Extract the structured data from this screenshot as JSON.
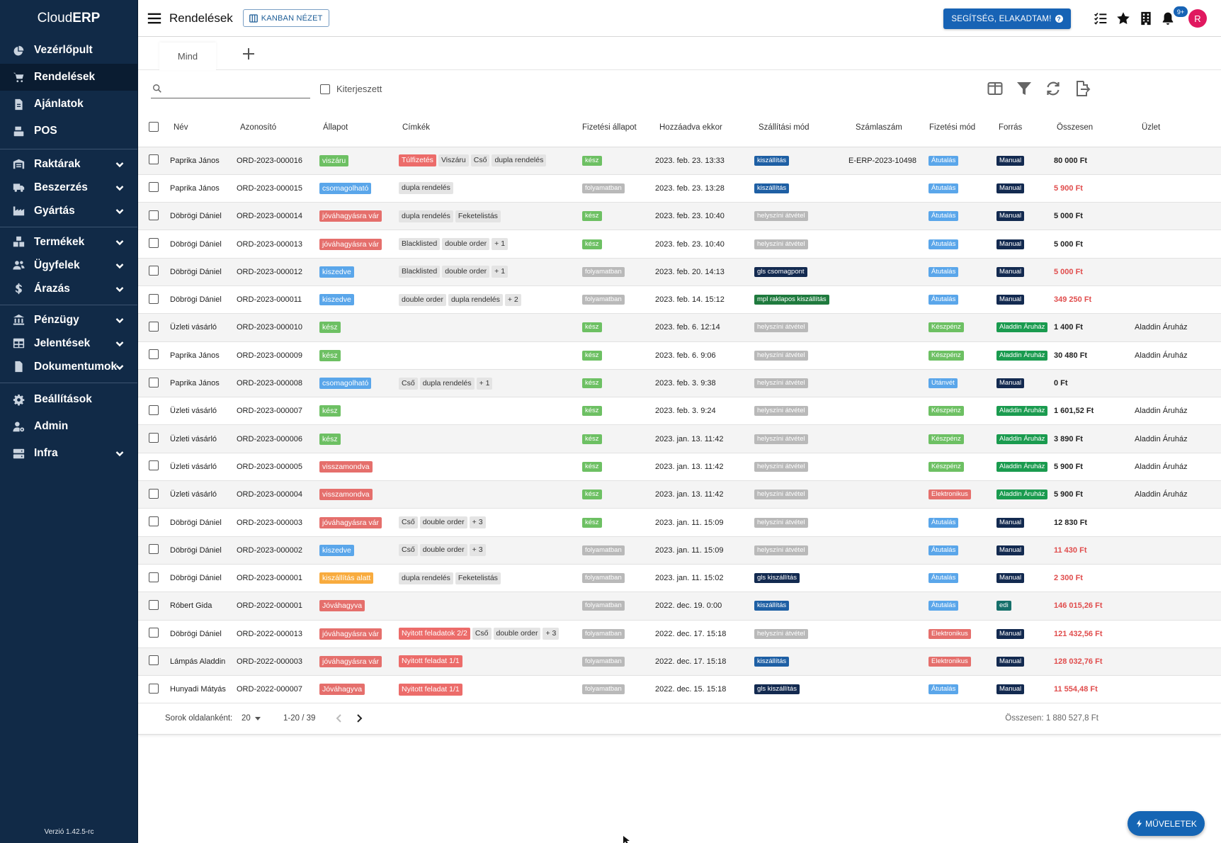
{
  "app": {
    "brand_prefix": "Cloud",
    "brand_suffix": "ERP",
    "version": "Verzió 1.42.5-rc"
  },
  "sidebar": {
    "items": [
      {
        "label": "Vezérlőpult",
        "icon": "chart-pie-icon",
        "active": false,
        "has_children": false
      },
      {
        "label": "Rendelések",
        "icon": "cart-icon",
        "active": true,
        "has_children": false
      },
      {
        "label": "Ajánlatok",
        "icon": "file-icon",
        "active": false,
        "has_children": false
      },
      {
        "label": "POS",
        "icon": "cash-register-icon",
        "active": false,
        "has_children": false
      },
      {
        "label": "Raktárak",
        "icon": "warehouse-icon",
        "active": false,
        "has_children": true
      },
      {
        "label": "Beszerzés",
        "icon": "truck-icon",
        "active": false,
        "has_children": true
      },
      {
        "label": "Gyártás",
        "icon": "industry-icon",
        "active": false,
        "has_children": true
      },
      {
        "label": "Termékek",
        "icon": "boxes-icon",
        "active": false,
        "has_children": true
      },
      {
        "label": "Ügyfelek",
        "icon": "users-icon",
        "active": false,
        "has_children": true
      },
      {
        "label": "Árazás",
        "icon": "dollar-icon",
        "active": false,
        "has_children": true
      },
      {
        "label": "Pénzügy",
        "icon": "bank-icon",
        "active": false,
        "has_children": true
      },
      {
        "label": "Jelentések",
        "icon": "table-icon",
        "active": false,
        "has_children": true
      },
      {
        "label": "Dokumentumok",
        "icon": "document-icon",
        "active": false,
        "has_children": true
      },
      {
        "label": "Beállítások",
        "icon": "gear-icon",
        "active": false,
        "has_children": false
      },
      {
        "label": "Admin",
        "icon": "user-gear-icon",
        "active": false,
        "has_children": false
      },
      {
        "label": "Infra",
        "icon": "server-icon",
        "active": false,
        "has_children": true
      }
    ]
  },
  "header": {
    "title": "Rendelések",
    "kanban_label": "KANBAN NÉZET",
    "help_label": "SEGÍTSÉG, ELAKADTAM!",
    "notification_count": "9+",
    "avatar_initial": "R"
  },
  "tabs": {
    "active": "Mind"
  },
  "toolbar": {
    "search_value": "",
    "search_placeholder": "",
    "expanded_label": "Kiterjeszett"
  },
  "table": {
    "columns": [
      "Név",
      "Azonosító",
      "Állapot",
      "Címkék",
      "Fizetési állapot",
      "Hozzáadva ekkor",
      "Szállítási mód",
      "Számlaszám",
      "Fizetési mód",
      "Forrás",
      "Összesen",
      "Üzlet"
    ],
    "rows": [
      {
        "name": "Paprika János",
        "id": "ORD-2023-000016",
        "status": "viszáru",
        "status_color": "green",
        "tags": [
          {
            "t": "Túlfizetés",
            "red": true
          },
          {
            "t": "Viszáru"
          },
          {
            "t": "Cső"
          },
          {
            "t": "dupla rendelés"
          }
        ],
        "payment_status": "kész",
        "pay_color": "green",
        "added": "2023. feb. 23. 13:33",
        "shipping": "kiszállítás",
        "ship_color": "darkblue",
        "invoice": "E-ERP-2023-10498",
        "payment_method": "Átutalás",
        "pm_color": "blue",
        "source": "Manual",
        "src_color": "navy",
        "total": "80 000 Ft",
        "total_red": false,
        "shop": ""
      },
      {
        "name": "Paprika János",
        "id": "ORD-2023-000015",
        "status": "csomagolható",
        "status_color": "blue",
        "tags": [
          {
            "t": "dupla rendelés"
          }
        ],
        "payment_status": "folyamatban",
        "pay_color": "grey",
        "added": "2023. feb. 23. 13:28",
        "shipping": "kiszállítás",
        "ship_color": "darkblue",
        "invoice": "",
        "payment_method": "Átutalás",
        "pm_color": "blue",
        "source": "Manual",
        "src_color": "navy",
        "total": "5 900 Ft",
        "total_red": true,
        "shop": ""
      },
      {
        "name": "Döbrögi Dániel",
        "id": "ORD-2023-000014",
        "status": "jóváhagyásra vár",
        "status_color": "red",
        "tags": [
          {
            "t": "dupla rendelés"
          },
          {
            "t": "Feketelistás"
          }
        ],
        "payment_status": "kész",
        "pay_color": "green",
        "added": "2023. feb. 23. 10:40",
        "shipping": "helyszíni átvétel",
        "ship_color": "grey",
        "invoice": "",
        "payment_method": "Átutalás",
        "pm_color": "blue",
        "source": "Manual",
        "src_color": "navy",
        "total": "5 000 Ft",
        "total_red": false,
        "shop": ""
      },
      {
        "name": "Döbrögi Dániel",
        "id": "ORD-2023-000013",
        "status": "jóváhagyásra vár",
        "status_color": "red",
        "tags": [
          {
            "t": "Blacklisted"
          },
          {
            "t": "double order"
          },
          {
            "t": "+ 1"
          }
        ],
        "payment_status": "kész",
        "pay_color": "green",
        "added": "2023. feb. 23. 10:40",
        "shipping": "helyszíni átvétel",
        "ship_color": "grey",
        "invoice": "",
        "payment_method": "Átutalás",
        "pm_color": "blue",
        "source": "Manual",
        "src_color": "navy",
        "total": "5 000 Ft",
        "total_red": false,
        "shop": ""
      },
      {
        "name": "Döbrögi Dániel",
        "id": "ORD-2023-000012",
        "status": "kiszedve",
        "status_color": "blue",
        "tags": [
          {
            "t": "Blacklisted"
          },
          {
            "t": "double order"
          },
          {
            "t": "+ 1"
          }
        ],
        "payment_status": "folyamatban",
        "pay_color": "grey",
        "added": "2023. feb. 20. 14:13",
        "shipping": "gls csomagpont",
        "ship_color": "navy",
        "invoice": "",
        "payment_method": "Átutalás",
        "pm_color": "blue",
        "source": "Manual",
        "src_color": "navy",
        "total": "5 000 Ft",
        "total_red": true,
        "shop": ""
      },
      {
        "name": "Döbrögi Dániel",
        "id": "ORD-2023-000011",
        "status": "kiszedve",
        "status_color": "blue",
        "tags": [
          {
            "t": "double order"
          },
          {
            "t": "dupla rendelés"
          },
          {
            "t": "+ 2"
          }
        ],
        "payment_status": "folyamatban",
        "pay_color": "grey",
        "added": "2023. feb. 14. 15:12",
        "shipping": "mpl raklapos kiszállítás",
        "ship_color": "darkgreen",
        "invoice": "",
        "payment_method": "Átutalás",
        "pm_color": "blue",
        "source": "Manual",
        "src_color": "navy",
        "total": "349 250 Ft",
        "total_red": true,
        "shop": ""
      },
      {
        "name": "Üzleti vásárló",
        "id": "ORD-2023-000010",
        "status": "kész",
        "status_color": "green",
        "tags": [],
        "payment_status": "kész",
        "pay_color": "green",
        "added": "2023. feb. 6. 12:14",
        "shipping": "helyszíni átvétel",
        "ship_color": "grey",
        "invoice": "",
        "payment_method": "Készpénz",
        "pm_color": "green",
        "source": "Aladdin Áruház",
        "src_color": "green2",
        "total": "1 400 Ft",
        "total_red": false,
        "shop": "Aladdin Áruház"
      },
      {
        "name": "Paprika János",
        "id": "ORD-2023-000009",
        "status": "kész",
        "status_color": "green",
        "tags": [],
        "payment_status": "kész",
        "pay_color": "green",
        "added": "2023. feb. 6. 9:06",
        "shipping": "helyszíni átvétel",
        "ship_color": "grey",
        "invoice": "",
        "payment_method": "Készpénz",
        "pm_color": "green",
        "source": "Aladdin Áruház",
        "src_color": "green2",
        "total": "30 480 Ft",
        "total_red": false,
        "shop": "Aladdin Áruház"
      },
      {
        "name": "Paprika János",
        "id": "ORD-2023-000008",
        "status": "csomagolható",
        "status_color": "blue",
        "tags": [
          {
            "t": "Cső"
          },
          {
            "t": "dupla rendelés"
          },
          {
            "t": "+ 1"
          }
        ],
        "payment_status": "kész",
        "pay_color": "green",
        "added": "2023. feb. 3. 9:38",
        "shipping": "helyszíni átvétel",
        "ship_color": "grey",
        "invoice": "",
        "payment_method": "Utánvét",
        "pm_color": "blue",
        "source": "Manual",
        "src_color": "navy",
        "total": "0 Ft",
        "total_red": false,
        "shop": ""
      },
      {
        "name": "Üzleti vásárló",
        "id": "ORD-2023-000007",
        "status": "kész",
        "status_color": "green",
        "tags": [],
        "payment_status": "kész",
        "pay_color": "green",
        "added": "2023. feb. 3. 9:24",
        "shipping": "helyszíni átvétel",
        "ship_color": "grey",
        "invoice": "",
        "payment_method": "Készpénz",
        "pm_color": "green",
        "source": "Aladdin Áruház",
        "src_color": "green2",
        "total": "1 601,52 Ft",
        "total_red": false,
        "shop": "Aladdin Áruház"
      },
      {
        "name": "Üzleti vásárló",
        "id": "ORD-2023-000006",
        "status": "kész",
        "status_color": "green",
        "tags": [],
        "payment_status": "kész",
        "pay_color": "green",
        "added": "2023. jan. 13. 11:42",
        "shipping": "helyszíni átvétel",
        "ship_color": "grey",
        "invoice": "",
        "payment_method": "Készpénz",
        "pm_color": "green",
        "source": "Aladdin Áruház",
        "src_color": "green2",
        "total": "3 890 Ft",
        "total_red": false,
        "shop": "Aladdin Áruház"
      },
      {
        "name": "Üzleti vásárló",
        "id": "ORD-2023-000005",
        "status": "visszamondva",
        "status_color": "red",
        "tags": [],
        "payment_status": "kész",
        "pay_color": "green",
        "added": "2023. jan. 13. 11:42",
        "shipping": "helyszíni átvétel",
        "ship_color": "grey",
        "invoice": "",
        "payment_method": "Készpénz",
        "pm_color": "green",
        "source": "Aladdin Áruház",
        "src_color": "green2",
        "total": "5 900 Ft",
        "total_red": false,
        "shop": "Aladdin Áruház"
      },
      {
        "name": "Üzleti vásárló",
        "id": "ORD-2023-000004",
        "status": "visszamondva",
        "status_color": "red",
        "tags": [],
        "payment_status": "kész",
        "pay_color": "green",
        "added": "2023. jan. 13. 11:42",
        "shipping": "helyszíni átvétel",
        "ship_color": "grey",
        "invoice": "",
        "payment_method": "Elektronikus",
        "pm_color": "red",
        "source": "Aladdin Áruház",
        "src_color": "green2",
        "total": "5 900 Ft",
        "total_red": false,
        "shop": "Aladdin Áruház"
      },
      {
        "name": "Döbrögi Dániel",
        "id": "ORD-2023-000003",
        "status": "jóváhagyásra vár",
        "status_color": "red",
        "tags": [
          {
            "t": "Cső"
          },
          {
            "t": "double order"
          },
          {
            "t": "+ 3"
          }
        ],
        "payment_status": "kész",
        "pay_color": "green",
        "added": "2023. jan. 11. 15:09",
        "shipping": "helyszíni átvétel",
        "ship_color": "grey",
        "invoice": "",
        "payment_method": "Átutalás",
        "pm_color": "blue",
        "source": "Manual",
        "src_color": "navy",
        "total": "12 830 Ft",
        "total_red": false,
        "shop": ""
      },
      {
        "name": "Döbrögi Dániel",
        "id": "ORD-2023-000002",
        "status": "kiszedve",
        "status_color": "blue",
        "tags": [
          {
            "t": "Cső"
          },
          {
            "t": "double order"
          },
          {
            "t": "+ 3"
          }
        ],
        "payment_status": "folyamatban",
        "pay_color": "grey",
        "added": "2023. jan. 11. 15:09",
        "shipping": "helyszíni átvétel",
        "ship_color": "grey",
        "invoice": "",
        "payment_method": "Átutalás",
        "pm_color": "blue",
        "source": "Manual",
        "src_color": "navy",
        "total": "11 430 Ft",
        "total_red": true,
        "shop": ""
      },
      {
        "name": "Döbrögi Dániel",
        "id": "ORD-2023-000001",
        "status": "kiszállítás alatt",
        "status_color": "orange",
        "tags": [
          {
            "t": "dupla rendelés"
          },
          {
            "t": "Feketelistás"
          }
        ],
        "payment_status": "folyamatban",
        "pay_color": "grey",
        "added": "2023. jan. 11. 15:02",
        "shipping": "gls kiszállítás",
        "ship_color": "navy",
        "invoice": "",
        "payment_method": "Átutalás",
        "pm_color": "blue",
        "source": "Manual",
        "src_color": "navy",
        "total": "2 300 Ft",
        "total_red": true,
        "shop": ""
      },
      {
        "name": "Róbert Gida",
        "id": "ORD-2022-000001",
        "status": "Jóváhagyva",
        "status_color": "red",
        "tags": [],
        "payment_status": "folyamatban",
        "pay_color": "grey",
        "added": "2022. dec. 19. 0:00",
        "shipping": "kiszállítás",
        "ship_color": "darkblue",
        "invoice": "",
        "payment_method": "Átutalás",
        "pm_color": "blue",
        "source": "edi",
        "src_color": "teal",
        "total": "146 015,26 Ft",
        "total_red": true,
        "shop": ""
      },
      {
        "name": "Döbrögi Dániel",
        "id": "ORD-2022-000013",
        "status": "jóváhagyásra vár",
        "status_color": "red",
        "tags": [
          {
            "t": "Nyitott feladatok 2/2",
            "red": true
          },
          {
            "t": "Cső"
          },
          {
            "t": "double order"
          },
          {
            "t": "+ 3"
          }
        ],
        "payment_status": "folyamatban",
        "pay_color": "grey",
        "added": "2022. dec. 17. 15:18",
        "shipping": "helyszíni átvétel",
        "ship_color": "grey",
        "invoice": "",
        "payment_method": "Elektronikus",
        "pm_color": "red",
        "source": "Manual",
        "src_color": "navy",
        "total": "121 432,56 Ft",
        "total_red": true,
        "shop": ""
      },
      {
        "name": "Lámpás Aladdin",
        "id": "ORD-2022-000003",
        "status": "jóváhagyásra vár",
        "status_color": "red",
        "tags": [
          {
            "t": "Nyitott feladat 1/1",
            "red": true
          }
        ],
        "payment_status": "folyamatban",
        "pay_color": "grey",
        "added": "2022. dec. 17. 15:18",
        "shipping": "kiszállítás",
        "ship_color": "darkblue",
        "invoice": "",
        "payment_method": "Elektronikus",
        "pm_color": "red",
        "source": "Manual",
        "src_color": "navy",
        "total": "128 032,76 Ft",
        "total_red": true,
        "shop": ""
      },
      {
        "name": "Hunyadi Mátyás",
        "id": "ORD-2022-000007",
        "status": "Jóváhagyva",
        "status_color": "red",
        "tags": [
          {
            "t": "Nyitott feladat 1/1",
            "red": true
          }
        ],
        "payment_status": "folyamatban",
        "pay_color": "grey",
        "added": "2022. dec. 15. 15:18",
        "shipping": "gls kiszállítás",
        "ship_color": "navy",
        "invoice": "",
        "payment_method": "Átutalás",
        "pm_color": "blue",
        "source": "Manual",
        "src_color": "navy",
        "total": "11 554,48 Ft",
        "total_red": true,
        "shop": ""
      }
    ]
  },
  "footer": {
    "rows_per_page_label": "Sorok oldalanként:",
    "rows_per_page_value": "20",
    "range": "1-20 / 39",
    "total": "Összesen: 1 880 527,8 Ft"
  },
  "fab": {
    "label": "MŰVELETEK"
  },
  "colors": {
    "sidebar_bg": "#112a47",
    "primary": "#1763b5",
    "avatar": "#e0185f",
    "total_red": "#e04c4c"
  }
}
